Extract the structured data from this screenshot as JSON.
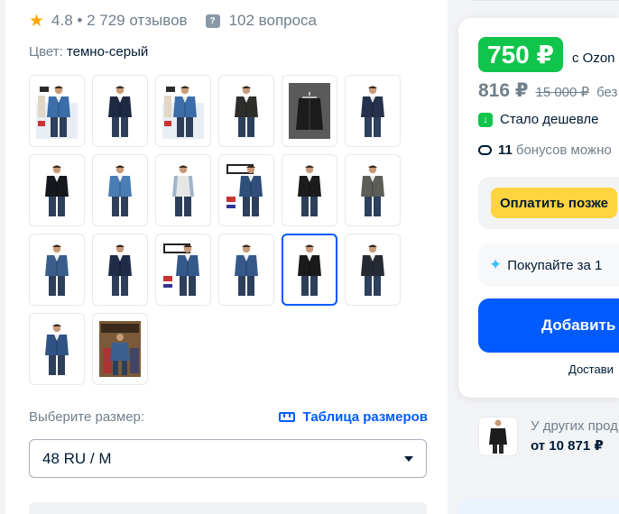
{
  "rating": {
    "score_reviews": "4.8 • 2 729 отзывов",
    "questions": "102 вопроса",
    "star_color": "#ffa800"
  },
  "color": {
    "label": "Цвет:",
    "value": "темно-серый"
  },
  "gallery": {
    "thumbs": [
      {
        "kind": "denim-light",
        "bg": "#e8eef4",
        "jacket": "#3b6ea8",
        "poster": "PREMIUM"
      },
      {
        "kind": "navy",
        "bg": "#ffffff",
        "jacket": "#1e2a44"
      },
      {
        "kind": "denim-light",
        "bg": "#e8eef4",
        "jacket": "#3b6ea8",
        "poster": "PREMIUM"
      },
      {
        "kind": "black",
        "bg": "#ffffff",
        "jacket": "#2d2d2b"
      },
      {
        "kind": "hanger",
        "bg": "#5a5a5a",
        "jacket": "#1c1c1c"
      },
      {
        "kind": "navy",
        "bg": "#ffffff",
        "jacket": "#26324d"
      },
      {
        "kind": "black",
        "bg": "#ffffff",
        "jacket": "#15181d"
      },
      {
        "kind": "denim-light",
        "bg": "#ffffff",
        "jacket": "#4a7db3"
      },
      {
        "kind": "vest",
        "bg": "#ffffff",
        "jacket": "#6d8fb5"
      },
      {
        "kind": "poster",
        "bg": "#ffffff",
        "jacket": "#2f4f7a",
        "poster": "КУРТКА"
      },
      {
        "kind": "black",
        "bg": "#ffffff",
        "jacket": "#1c1c1c"
      },
      {
        "kind": "grey",
        "bg": "#ffffff",
        "jacket": "#5c5e58"
      },
      {
        "kind": "denim",
        "bg": "#ffffff",
        "jacket": "#3a5d8c"
      },
      {
        "kind": "navy",
        "bg": "#ffffff",
        "jacket": "#1f2b47"
      },
      {
        "kind": "poster",
        "bg": "#ffffff",
        "jacket": "#34588a",
        "poster": "КУРТКА"
      },
      {
        "kind": "denim",
        "bg": "#ffffff",
        "jacket": "#36598a"
      },
      {
        "kind": "black-selected",
        "bg": "#ffffff",
        "jacket": "#1a1a1a",
        "selected": true
      },
      {
        "kind": "black",
        "bg": "#ffffff",
        "jacket": "#262a33"
      },
      {
        "kind": "denim",
        "bg": "#ffffff",
        "jacket": "#2f5384"
      },
      {
        "kind": "store",
        "bg": "#7a5a3a",
        "jacket": "#3a5f8e",
        "poster": "PREMIUM"
      }
    ]
  },
  "size": {
    "label": "Выберите размер:",
    "table_link": "Таблица размеров",
    "selected": "48 RU / M"
  },
  "price_card": {
    "price": "750 ₽",
    "ozon_text": "с Ozon",
    "price_without": "816 ₽",
    "old_price": "15 000 ₽",
    "without_text": "без",
    "cheaper": "Стало дешевле",
    "bonus_count": "11",
    "bonus_text": "бонусов можно",
    "pay_later": "Оплатить позже",
    "buy_for": "Покупайте за 1",
    "add_button": "Добавить",
    "delivery": "Достави",
    "green_color": "#10c44c",
    "blue_color": "#005bff",
    "yellow_color": "#ffd43f"
  },
  "other_sellers": {
    "text": "У других прод",
    "price": "от 10 871 ₽"
  }
}
